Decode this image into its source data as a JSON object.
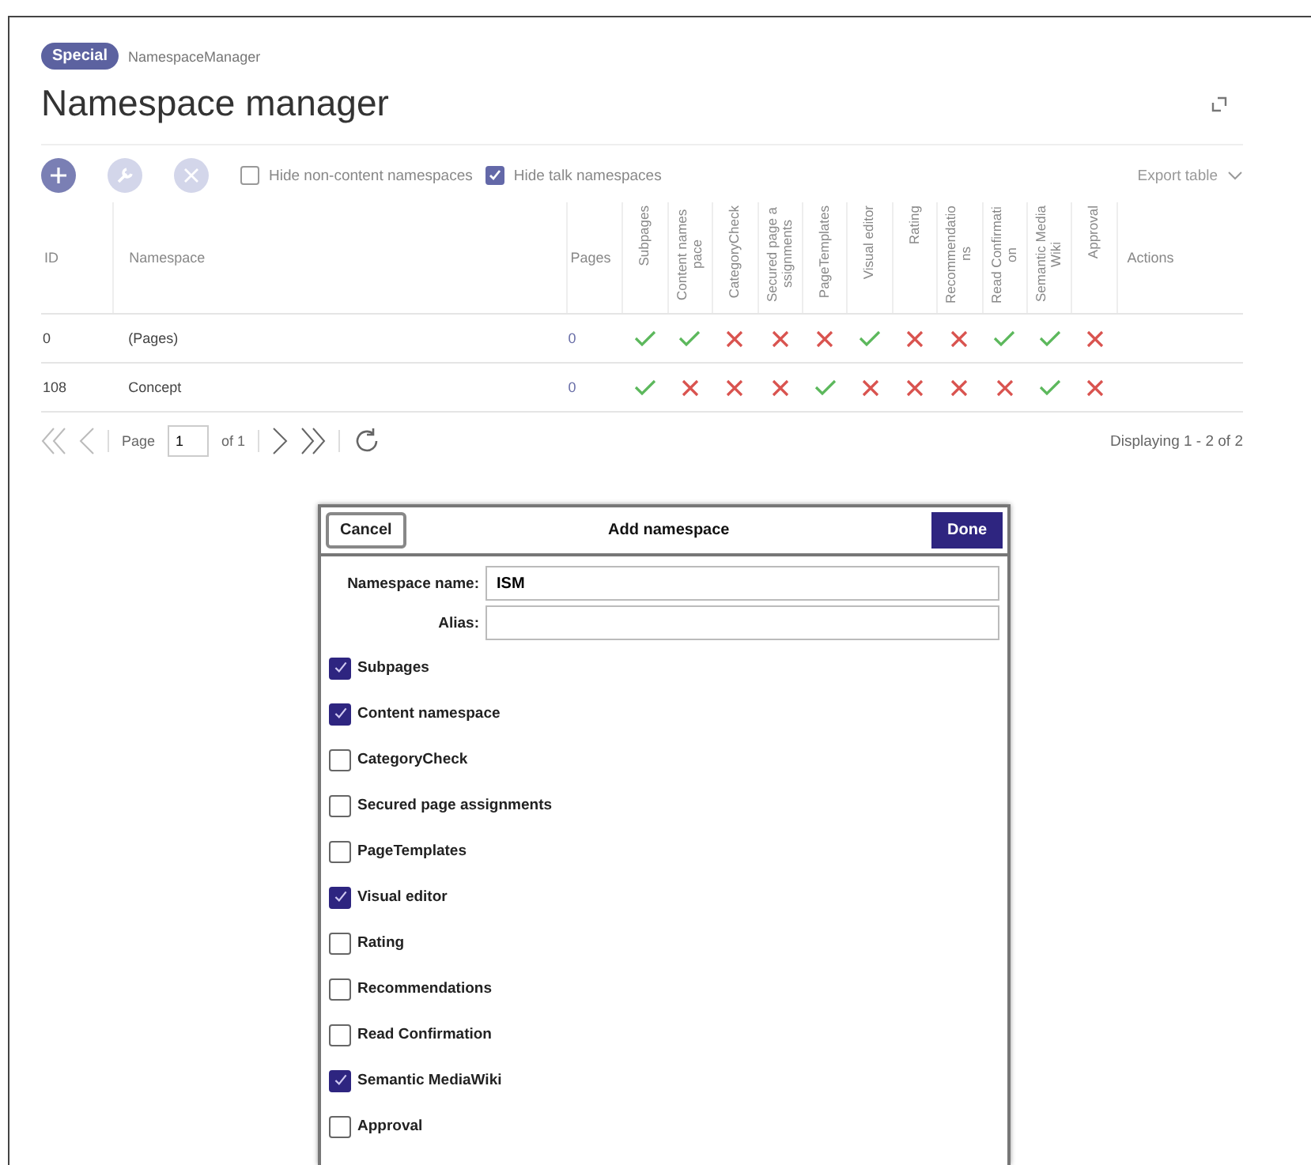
{
  "breadcrumb": {
    "badge": "Special",
    "page": "NamespaceManager"
  },
  "title": "Namespace manager",
  "toolbar": {
    "buttons": [
      {
        "kind": "add",
        "disabled": false
      },
      {
        "kind": "edit",
        "disabled": true
      },
      {
        "kind": "remove",
        "disabled": true
      }
    ],
    "filters": [
      {
        "label": "Hide non-content namespaces",
        "checked": false
      },
      {
        "label": "Hide talk namespaces",
        "checked": true
      }
    ],
    "export": "Export table"
  },
  "table": {
    "columns": {
      "id": "ID",
      "namespace": "Namespace",
      "pages": "Pages",
      "features": [
        "Subpages",
        "Content namespace",
        "CategoryCheck",
        "Secured page assignments",
        "PageTemplates",
        "Visual editor",
        "Rating",
        "Recommendations",
        "Read Confirmation",
        "Semantic MediaWiki",
        "Approval"
      ],
      "actions": "Actions"
    },
    "rows": [
      {
        "id": "0",
        "namespace": "(Pages)",
        "pages": "0",
        "features": [
          true,
          true,
          false,
          false,
          false,
          true,
          false,
          false,
          true,
          true,
          false
        ]
      },
      {
        "id": "108",
        "namespace": "Concept",
        "pages": "0",
        "features": [
          true,
          false,
          false,
          false,
          true,
          false,
          false,
          false,
          false,
          true,
          false
        ]
      }
    ]
  },
  "pager": {
    "page_label": "Page",
    "page": "1",
    "of": "of 1",
    "display": "Displaying 1 - 2 of 2"
  },
  "dialog": {
    "cancel": "Cancel",
    "title": "Add namespace",
    "done": "Done",
    "fields": [
      {
        "label": "Namespace name:",
        "value": "ISM"
      },
      {
        "label": "Alias:"
      }
    ],
    "options": [
      {
        "label": "Subpages",
        "checked": true
      },
      {
        "label": "Content namespace",
        "checked": true
      },
      {
        "label": "CategoryCheck",
        "checked": false
      },
      {
        "label": "Secured page assignments",
        "checked": false
      },
      {
        "label": "PageTemplates",
        "checked": false
      },
      {
        "label": "Visual editor",
        "checked": true
      },
      {
        "label": "Rating",
        "checked": false
      },
      {
        "label": "Recommendations",
        "checked": false
      },
      {
        "label": "Read Confirmation",
        "checked": false
      },
      {
        "label": "Semantic MediaWiki",
        "checked": true
      },
      {
        "label": "Approval",
        "checked": false
      }
    ]
  }
}
